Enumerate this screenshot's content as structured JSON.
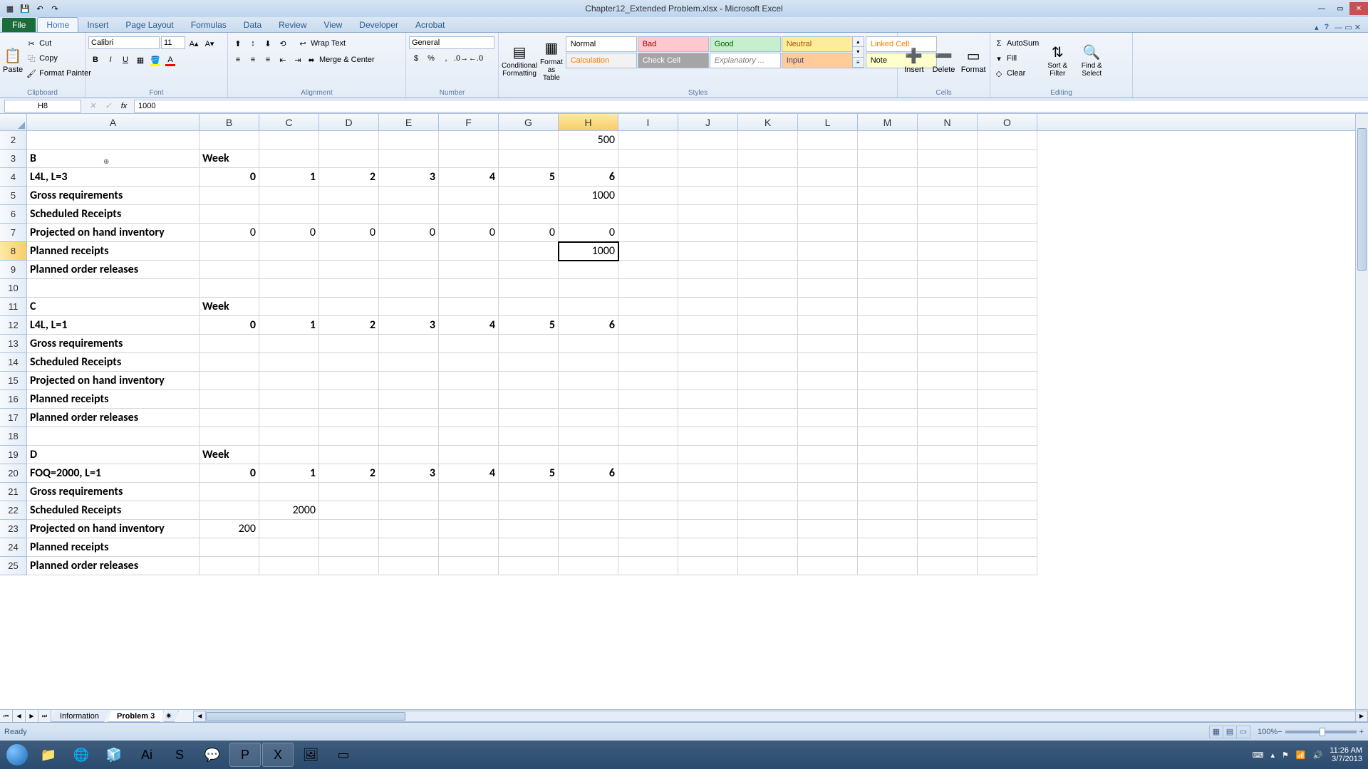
{
  "title": "Chapter12_Extended Problem.xlsx - Microsoft Excel",
  "tabs": {
    "file": "File",
    "home": "Home",
    "insert": "Insert",
    "pagelayout": "Page Layout",
    "formulas": "Formulas",
    "data": "Data",
    "review": "Review",
    "view": "View",
    "developer": "Developer",
    "acrobat": "Acrobat"
  },
  "clipboard": {
    "label": "Clipboard",
    "paste": "Paste",
    "cut": "Cut",
    "copy": "Copy",
    "painter": "Format Painter"
  },
  "font": {
    "label": "Font",
    "family": "Calibri",
    "size": "11"
  },
  "alignment": {
    "label": "Alignment",
    "wrap": "Wrap Text",
    "merge": "Merge & Center"
  },
  "number": {
    "label": "Number",
    "format": "General"
  },
  "styles": {
    "label": "Styles",
    "conditional": "Conditional Formatting",
    "astable": "Format as Table",
    "normal": "Normal",
    "bad": "Bad",
    "good": "Good",
    "neutral": "Neutral",
    "calc": "Calculation",
    "check": "Check Cell",
    "expl": "Explanatory ...",
    "input": "Input",
    "linked": "Linked Cell",
    "note": "Note"
  },
  "cells": {
    "label": "Cells",
    "insert": "Insert",
    "delete": "Delete",
    "format": "Format"
  },
  "editing": {
    "label": "Editing",
    "autosum": "AutoSum",
    "fill": "Fill",
    "clear": "Clear",
    "sort": "Sort & Filter",
    "find": "Find & Select"
  },
  "namebox": "H8",
  "formula": "1000",
  "cols": [
    "A",
    "B",
    "C",
    "D",
    "E",
    "F",
    "G",
    "H",
    "I",
    "J",
    "K",
    "L",
    "M",
    "N",
    "O"
  ],
  "selectedColIdx": 7,
  "rows": [
    {
      "n": 2,
      "cells": {
        "H": "500"
      },
      "rAlign": [
        "H"
      ]
    },
    {
      "n": 3,
      "cells": {
        "A": "B",
        "B": "Week"
      },
      "bold": true
    },
    {
      "n": 4,
      "cells": {
        "A": "L4L, L=3",
        "B": "0",
        "C": "1",
        "D": "2",
        "E": "3",
        "F": "4",
        "G": "5",
        "H": "6"
      },
      "bold": true,
      "rAlign": [
        "B",
        "C",
        "D",
        "E",
        "F",
        "G",
        "H"
      ]
    },
    {
      "n": 5,
      "cells": {
        "A": "Gross requirements",
        "H": "1000"
      },
      "boldA": true,
      "rAlign": [
        "H"
      ]
    },
    {
      "n": 6,
      "cells": {
        "A": "Scheduled Receipts"
      },
      "boldA": true
    },
    {
      "n": 7,
      "cells": {
        "A": "Projected on hand inventory",
        "B": "0",
        "C": "0",
        "D": "0",
        "E": "0",
        "F": "0",
        "G": "0",
        "H": "0"
      },
      "boldA": true,
      "rAlign": [
        "B",
        "C",
        "D",
        "E",
        "F",
        "G",
        "H"
      ]
    },
    {
      "n": 8,
      "cells": {
        "A": "Planned receipts",
        "H": "1000"
      },
      "boldA": true,
      "rAlign": [
        "H"
      ],
      "sel": "H"
    },
    {
      "n": 9,
      "cells": {
        "A": "Planned order releases"
      },
      "boldA": true
    },
    {
      "n": 10,
      "cells": {}
    },
    {
      "n": 11,
      "cells": {
        "A": "C",
        "B": "Week"
      },
      "bold": true
    },
    {
      "n": 12,
      "cells": {
        "A": "L4L, L=1",
        "B": "0",
        "C": "1",
        "D": "2",
        "E": "3",
        "F": "4",
        "G": "5",
        "H": "6"
      },
      "bold": true,
      "rAlign": [
        "B",
        "C",
        "D",
        "E",
        "F",
        "G",
        "H"
      ]
    },
    {
      "n": 13,
      "cells": {
        "A": "Gross requirements"
      },
      "boldA": true
    },
    {
      "n": 14,
      "cells": {
        "A": "Scheduled Receipts"
      },
      "boldA": true
    },
    {
      "n": 15,
      "cells": {
        "A": "Projected on hand inventory"
      },
      "boldA": true
    },
    {
      "n": 16,
      "cells": {
        "A": "Planned receipts"
      },
      "boldA": true
    },
    {
      "n": 17,
      "cells": {
        "A": "Planned order releases"
      },
      "boldA": true
    },
    {
      "n": 18,
      "cells": {}
    },
    {
      "n": 19,
      "cells": {
        "A": "D",
        "B": "Week"
      },
      "bold": true
    },
    {
      "n": 20,
      "cells": {
        "A": "FOQ=2000, L=1",
        "B": "0",
        "C": "1",
        "D": "2",
        "E": "3",
        "F": "4",
        "G": "5",
        "H": "6"
      },
      "bold": true,
      "rAlign": [
        "B",
        "C",
        "D",
        "E",
        "F",
        "G",
        "H"
      ]
    },
    {
      "n": 21,
      "cells": {
        "A": "Gross requirements"
      },
      "boldA": true
    },
    {
      "n": 22,
      "cells": {
        "A": "Scheduled Receipts",
        "C": "2000"
      },
      "boldA": true,
      "rAlign": [
        "C"
      ]
    },
    {
      "n": 23,
      "cells": {
        "A": "Projected on hand inventory",
        "B": "200"
      },
      "boldA": true,
      "rAlign": [
        "B"
      ]
    },
    {
      "n": 24,
      "cells": {
        "A": "Planned receipts"
      },
      "boldA": true
    },
    {
      "n": 25,
      "cells": {
        "A": "Planned order releases"
      },
      "boldA": true
    }
  ],
  "selectedRow": 8,
  "sheets": {
    "s1": "Information",
    "s2": "Problem 3"
  },
  "statusbar": {
    "ready": "Ready",
    "zoom": "100%"
  },
  "tray": {
    "time": "11:26 AM",
    "date": "3/7/2013"
  }
}
